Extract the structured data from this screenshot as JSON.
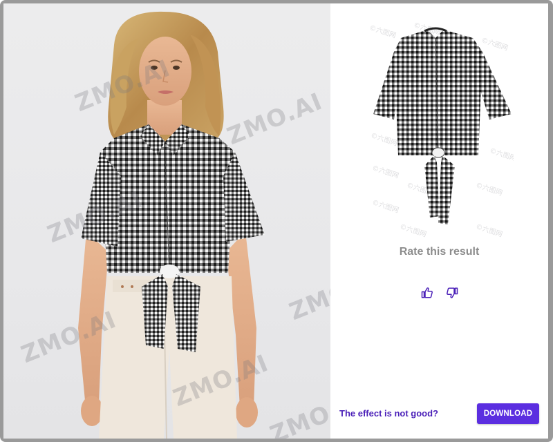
{
  "watermark": {
    "text": "ZMO.AI",
    "product_text": "©六图网"
  },
  "rating": {
    "title": "Rate this result",
    "thumbs_up_icon": "thumbs-up-icon",
    "thumbs_down_icon": "thumbs-down-icon"
  },
  "footer": {
    "feedback_link": "The effect is not good?",
    "download_label": "DOWNLOAD"
  },
  "colors": {
    "accent": "#5b2ee0",
    "link": "#4a1fb8",
    "muted_text": "#8c8c8c",
    "frame": "#9a9a9a"
  }
}
